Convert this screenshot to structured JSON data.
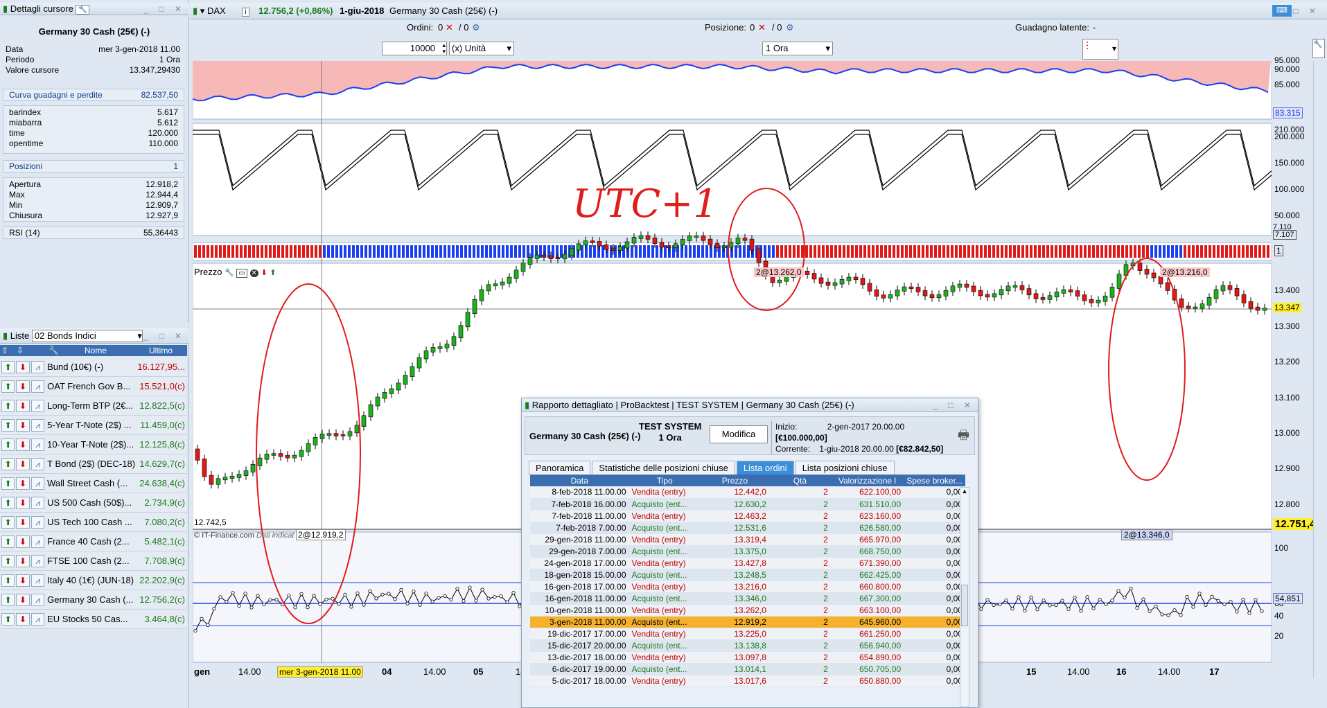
{
  "cursor_panel": {
    "title": "Dettagli cursore",
    "instrument": "Germany 30 Cash (25€) (-)",
    "rows": [
      {
        "label": "Data",
        "value": "mer 3-gen-2018 11.00"
      },
      {
        "label": "Periodo",
        "value": "1 Ora"
      },
      {
        "label": "Valore cursore",
        "value": "13.347,29430"
      }
    ],
    "pnl_label": "Curva guadagni e perdite",
    "pnl_value": "82.537,50",
    "vars": [
      {
        "label": "barindex",
        "value": "5.617"
      },
      {
        "label": "miabarra",
        "value": "5.612"
      },
      {
        "label": "time",
        "value": "120.000"
      },
      {
        "label": "opentime",
        "value": "110.000"
      }
    ],
    "positions_label": "Posizioni",
    "positions_value": "1",
    "ohlc": [
      {
        "label": "Apertura",
        "value": "12.918,2"
      },
      {
        "label": "Max",
        "value": "12.944,4"
      },
      {
        "label": "Min",
        "value": "12.909,7"
      },
      {
        "label": "Chiusura",
        "value": "12.927,9"
      }
    ],
    "rsi_label": "RSI (14)",
    "rsi_value": "55,36443"
  },
  "lists_panel": {
    "title": "Liste",
    "selected_list": "02 Bonds Indici",
    "col_name": "Nome",
    "col_last": "Ultimo",
    "items": [
      {
        "name": "Bund (10€) (-)",
        "value": "16.127,95...",
        "color": "#c00000"
      },
      {
        "name": "OAT French Gov B...",
        "value": "15.521,0(c)",
        "color": "#c00000"
      },
      {
        "name": "Long-Term BTP (2€...",
        "value": "12.822,5(c)",
        "color": "#1f7a1f"
      },
      {
        "name": "5-Year T-Note (2$) ...",
        "value": "11.459,0(c)",
        "color": "#1f7a1f"
      },
      {
        "name": "10-Year T-Note (2$)...",
        "value": "12.125,8(c)",
        "color": "#1f7a1f"
      },
      {
        "name": "T Bond (2$) (DEC-18)",
        "value": "14.629,7(c)",
        "color": "#1f7a1f"
      },
      {
        "name": "Wall Street Cash (...",
        "value": "24.638,4(c)",
        "color": "#1f7a1f"
      },
      {
        "name": "US 500 Cash (50$)...",
        "value": "2.734,9(c)",
        "color": "#1f7a1f"
      },
      {
        "name": "US Tech 100 Cash ...",
        "value": "7.080,2(c)",
        "color": "#1f7a1f"
      },
      {
        "name": "France 40 Cash (2...",
        "value": "5.482,1(c)",
        "color": "#1f7a1f"
      },
      {
        "name": "FTSE 100 Cash (2...",
        "value": "7.708,9(c)",
        "color": "#1f7a1f"
      },
      {
        "name": "Italy 40 (1€) (JUN-18)",
        "value": "22.202,9(c)",
        "color": "#1f7a1f"
      },
      {
        "name": "Germany 30 Cash (...",
        "value": "12.756,2(c)",
        "color": "#1f7a1f"
      },
      {
        "name": "EU Stocks 50 Cas...",
        "value": "3.464,8(c)",
        "color": "#1f7a1f"
      }
    ]
  },
  "chart_header": {
    "symbol": "DAX",
    "price_change": "12.756,2 (+0,86%)",
    "date": "1-giu-2018",
    "instrument": "Germany 30 Cash (25€) (-)",
    "orders_label": "Ordini:",
    "orders_value": "0",
    "orders_total": "/ 0",
    "position_label": "Posizione:",
    "position_value": "0",
    "position_total": "/ 0",
    "latent_label": "Guadagno latente:",
    "latent_value": "-",
    "qty_value": "10000",
    "qty_unit": "(x) Unità",
    "period": "1 Ora"
  },
  "chart_labels": {
    "price_panel": "Prezzo",
    "low_label": "12.742,5",
    "copyright": "© IT-Finance.com",
    "data_indic": "Dati indicat",
    "buy_marker_1": "2@12.919,2",
    "sell_marker_1": "2@13.262,0",
    "sell_marker_2": "2@13.216,0",
    "buy_marker_2": "2@13.346,0",
    "cursor_price": "13.347",
    "last_price": "12.751,4",
    "rsi_value": "54,851",
    "pnl_value": "83.315",
    "osc_a": "7.110",
    "osc_b": "7.107",
    "bar_value": "1",
    "handwritten": "UTC+1"
  },
  "axes": {
    "equity_ticks": [
      "95.000",
      "90.000",
      "85.000"
    ],
    "time_ticks": [
      "210.000",
      "200.000",
      "150.000",
      "100.000",
      "50.000"
    ],
    "price_ticks": [
      "13.400",
      "13.300",
      "13.200",
      "13.100",
      "13.000",
      "12.900",
      "12.800"
    ],
    "rsi_ticks": [
      "100",
      "60",
      "40",
      "20"
    ],
    "x_labels": [
      "gen",
      "14.00",
      "04",
      "14.00",
      "05",
      "14.00",
      "15",
      "14.00",
      "16",
      "14.00",
      "17"
    ],
    "x_cursor_label": "mer 3-gen-2018 11.00"
  },
  "report": {
    "title_parts": [
      "Rapporto dettagliato",
      "ProBacktest",
      "TEST SYSTEM",
      "Germany 30 Cash (25€) (-)"
    ],
    "instrument": "Germany 30 Cash (25€) (-)",
    "system": "TEST SYSTEM",
    "period": "1 Ora",
    "modify_btn": "Modifica",
    "start_label": "Inizio:",
    "start_date": "2-gen-2017 20.00.00",
    "start_value": "[€100.000,00]",
    "current_label": "Corrente:",
    "current_date": "1-giu-2018 20.00.00",
    "current_value": "[€82.842,50]",
    "tabs": [
      "Panoramica",
      "Statistiche delle posizioni chiuse",
      "Lista ordini",
      "Lista posizioni chiuse"
    ],
    "columns": [
      "Data",
      "Tipo",
      "Prezzo",
      "Qtà",
      "Valorizzazione l",
      "Spese broker..."
    ],
    "orders": [
      [
        "8-feb-2018 11.00.00",
        "Vendita (entry)",
        "12.442,0",
        "2",
        "622.100,00",
        "0,00"
      ],
      [
        "7-feb-2018 16.00.00",
        "Acquisto (ent...",
        "12.630,2",
        "2",
        "631.510,00",
        "0,00"
      ],
      [
        "7-feb-2018 11.00.00",
        "Vendita (entry)",
        "12.463,2",
        "2",
        "623.160,00",
        "0,00"
      ],
      [
        "7-feb-2018 7.00.00",
        "Acquisto (ent...",
        "12.531,6",
        "2",
        "626.580,00",
        "0,00"
      ],
      [
        "29-gen-2018 11.00.00",
        "Vendita (entry)",
        "13.319,4",
        "2",
        "665.970,00",
        "0,00"
      ],
      [
        "29-gen-2018 7.00.00",
        "Acquisto (ent...",
        "13.375,0",
        "2",
        "668.750,00",
        "0,00"
      ],
      [
        "24-gen-2018 17.00.00",
        "Vendita (entry)",
        "13.427,8",
        "2",
        "671.390,00",
        "0,00"
      ],
      [
        "18-gen-2018 15.00.00",
        "Acquisto (ent...",
        "13.248,5",
        "2",
        "662.425,00",
        "0,00"
      ],
      [
        "16-gen-2018 17.00.00",
        "Vendita (entry)",
        "13.216,0",
        "2",
        "660.800,00",
        "0,00"
      ],
      [
        "16-gen-2018 11.00.00",
        "Acquisto (ent...",
        "13.346,0",
        "2",
        "667.300,00",
        "0,00"
      ],
      [
        "10-gen-2018 11.00.00",
        "Vendita (entry)",
        "13.262,0",
        "2",
        "663.100,00",
        "0,00"
      ],
      [
        "3-gen-2018 11.00.00",
        "Acquisto (ent...",
        "12.919,2",
        "2",
        "645.960,00",
        "0,00"
      ],
      [
        "19-dic-2017 17.00.00",
        "Vendita (entry)",
        "13.225,0",
        "2",
        "661.250,00",
        "0,00"
      ],
      [
        "15-dic-2017 20.00.00",
        "Acquisto (ent...",
        "13.138,8",
        "2",
        "656.940,00",
        "0,00"
      ],
      [
        "13-dic-2017 18.00.00",
        "Vendita (entry)",
        "13.097,8",
        "2",
        "654.890,00",
        "0,00"
      ],
      [
        "6-dic-2017 19.00.00",
        "Acquisto (ent...",
        "13.014,1",
        "2",
        "650.705,00",
        "0,00"
      ],
      [
        "5-dic-2017 18.00.00",
        "Vendita (entry)",
        "13.017,6",
        "2",
        "650.880,00",
        "0,00"
      ]
    ],
    "selected_index": 11
  }
}
